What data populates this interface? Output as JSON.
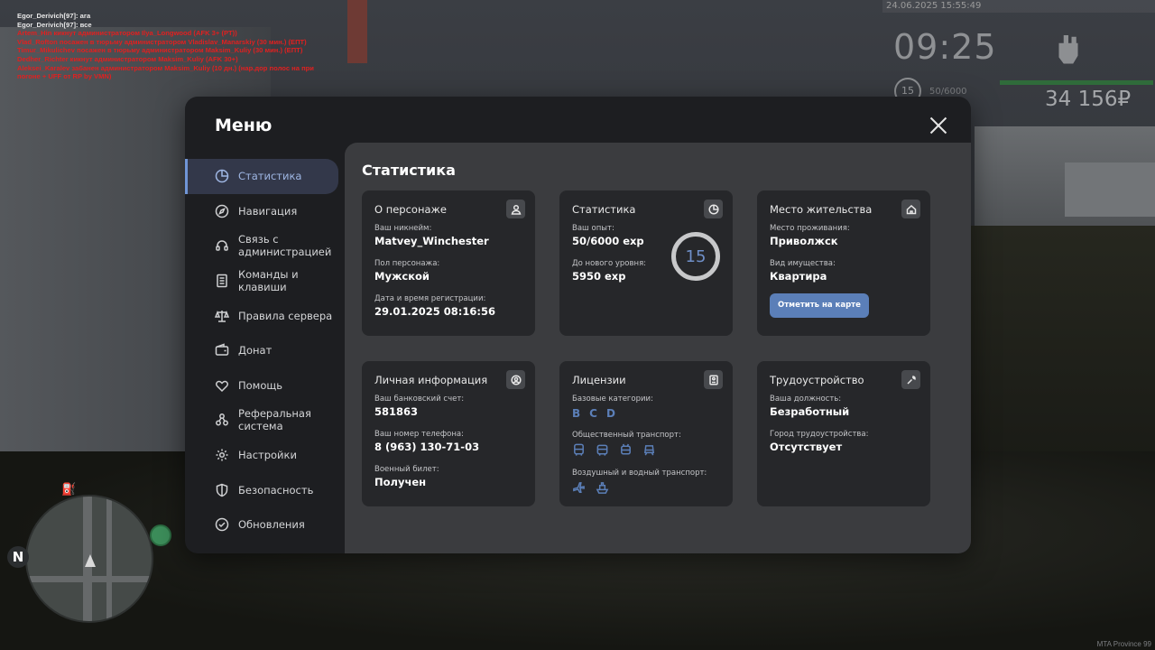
{
  "chat": [
    {
      "text": "Egor_Derivich[97]: ага",
      "color": "white"
    },
    {
      "text": "Egor_Derivich[97]: все",
      "color": "white"
    },
    {
      "text": "Artem_Hin кикнут администратором Ilya_Longwood (AFK 3+ (PT))",
      "color": "red"
    },
    {
      "text": "Vlad_Rofton посажен в тюрьму администратором Vladislav_Manarskiy (30 мин.) (ЕПТ)",
      "color": "red"
    },
    {
      "text": "Timur_Mikulichev посажен в тюрьму администратором Maksim_Kuliy (30 мин.) (ЕПТ)",
      "color": "red"
    },
    {
      "text": "Dedher_Richter кикнут администратором Maksim_Kuliy (AFK 30+)",
      "color": "red"
    },
    {
      "text": "Aleksei_Karalev забанен администратором Maksim_Kuliy (10 дн.) (нар.дор полос на при погоне + UFF от RP by VMN)",
      "color": "red"
    }
  ],
  "hud": {
    "datetime": "24.06.2025 15:55:49",
    "time": "09:25",
    "level": "15",
    "exp": "50/6000",
    "money": "34 156₽"
  },
  "watermark": "MTA Province 99",
  "colors": {
    "accent": "#5b7fb8",
    "active_nav": "#9fb7e4"
  },
  "menu": {
    "title": "Меню",
    "nav": [
      {
        "label": "Статистика",
        "icon": "pie-chart-icon",
        "active": true
      },
      {
        "label": "Навигация",
        "icon": "compass-icon"
      },
      {
        "label": "Связь с\nадминистрацией",
        "icon": "headset-icon"
      },
      {
        "label": "Команды и\nклавиши",
        "icon": "keyboard-list-icon"
      },
      {
        "label": "Правила сервера",
        "icon": "scales-icon"
      },
      {
        "label": "Донат",
        "icon": "wallet-icon"
      },
      {
        "label": "Помощь",
        "icon": "handshake-heart-icon"
      },
      {
        "label": "Реферальная\nсистема",
        "icon": "referral-nodes-icon"
      },
      {
        "label": "Настройки",
        "icon": "gear-icon"
      },
      {
        "label": "Безопасность",
        "icon": "shield-icon"
      },
      {
        "label": "Обновления",
        "icon": "check-circle-icon"
      }
    ]
  },
  "content": {
    "title": "Статистика",
    "persona": {
      "heading": "О персонаже",
      "nick_label": "Ваш никнейм:",
      "nick": "Matvey_Winchester",
      "gender_label": "Пол персонажа:",
      "gender": "Мужской",
      "reg_label": "Дата и время регистрации:",
      "reg": "29.01.2025 08:16:56"
    },
    "stats": {
      "heading": "Статистика",
      "exp_label": "Ваш опыт:",
      "exp": "50/6000 exp",
      "next_label": "До нового уровня:",
      "next": "5950 exp",
      "level": "15"
    },
    "residence": {
      "heading": "Место жительства",
      "place_label": "Место проживания:",
      "place": "Приволжск",
      "property_label": "Вид имущества:",
      "property": "Квартира",
      "map_button": "Отметить на карте"
    },
    "personal": {
      "heading": "Личная информация",
      "bank_label": "Ваш банковский счет:",
      "bank": "581863",
      "phone_label": "Ваш номер телефона:",
      "phone": "8 (963) 130-71-03",
      "military_label": "Военный билет:",
      "military": "Получен"
    },
    "licenses": {
      "heading": "Лицензии",
      "base_label": "Базовые категории:",
      "base": [
        "B",
        "C",
        "D"
      ],
      "public_label": "Общественный транспорт:",
      "air_label": "Воздушный и водный транспорт:"
    },
    "employment": {
      "heading": "Трудоустройство",
      "position_label": "Ваша должность:",
      "position": "Безработный",
      "city_label": "Город трудоустройства:",
      "city": "Отсутствует"
    }
  }
}
